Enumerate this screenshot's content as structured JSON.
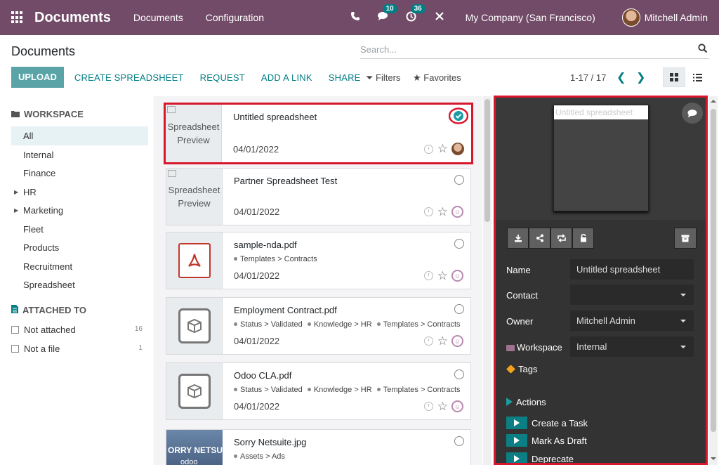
{
  "navbar": {
    "brand": "Documents",
    "menus": [
      "Documents",
      "Configuration"
    ],
    "chat_count": "10",
    "activity_count": "36",
    "company": "My Company (San Francisco)",
    "user": "Mitchell Admin",
    "color": "#714b67"
  },
  "control_panel": {
    "title": "Documents",
    "search_placeholder": "Search...",
    "upload_label": "UPLOAD",
    "create_spreadsheet_label": "CREATE SPREADSHEET",
    "request_label": "REQUEST",
    "add_link_label": "ADD A LINK",
    "share_label": "SHARE",
    "filters_label": "Filters",
    "favorites_label": "Favorites",
    "pager": "1-17 / 17"
  },
  "sidebar": {
    "workspace_title": "WORKSPACE",
    "workspaces": [
      {
        "label": "All",
        "active": true,
        "expandable": false
      },
      {
        "label": "Internal",
        "active": false,
        "expandable": false
      },
      {
        "label": "Finance",
        "active": false,
        "expandable": false
      },
      {
        "label": "HR",
        "active": false,
        "expandable": true
      },
      {
        "label": "Marketing",
        "active": false,
        "expandable": true
      },
      {
        "label": "Fleet",
        "active": false,
        "expandable": false
      },
      {
        "label": "Products",
        "active": false,
        "expandable": false
      },
      {
        "label": "Recruitment",
        "active": false,
        "expandable": false
      },
      {
        "label": "Spreadsheet",
        "active": false,
        "expandable": false
      }
    ],
    "attached_title": "ATTACHED TO",
    "attached": [
      {
        "label": "Not attached",
        "count": "16"
      },
      {
        "label": "Not a file",
        "count": "1"
      }
    ]
  },
  "documents": [
    {
      "name": "Untitled spreadsheet",
      "date": "04/01/2022",
      "thumb": "spreadsheet",
      "thumb_text": [
        "Spreadsheet",
        "Preview"
      ],
      "tags": [],
      "selected": true
    },
    {
      "name": "Partner Spreadsheet Test",
      "date": "04/01/2022",
      "thumb": "spreadsheet",
      "thumb_text": [
        "Spreadsheet",
        "Preview"
      ],
      "tags": [],
      "selected": false
    },
    {
      "name": "sample-nda.pdf",
      "date": "04/01/2022",
      "thumb": "pdf",
      "tags": [
        "Templates > Contracts"
      ],
      "selected": false
    },
    {
      "name": "Employment Contract.pdf",
      "date": "04/01/2022",
      "thumb": "box",
      "tags": [
        "Status > Validated",
        "Knowledge > HR",
        "Templates > Contracts"
      ],
      "selected": false
    },
    {
      "name": "Odoo CLA.pdf",
      "date": "04/01/2022",
      "thumb": "box",
      "tags": [
        "Status > Validated",
        "Knowledge > HR",
        "Templates > Contracts"
      ],
      "selected": false
    },
    {
      "name": "Sorry Netsuite.jpg",
      "date": "",
      "thumb": "image",
      "thumb_text": [
        "ORRY NETSUIT",
        "odoo"
      ],
      "tags": [
        "Assets > Ads"
      ],
      "selected": false
    }
  ],
  "preview": {
    "image_alt": "Untitled spreadsheet",
    "name_label": "Name",
    "name_value": "Untitled spreadsheet",
    "contact_label": "Contact",
    "contact_value": "",
    "owner_label": "Owner",
    "owner_value": "Mitchell Admin",
    "workspace_label": "Workspace",
    "workspace_value": "Internal",
    "tags_label": "Tags",
    "actions_label": "Actions",
    "actions": [
      "Create a Task",
      "Mark As Draft",
      "Deprecate"
    ]
  }
}
